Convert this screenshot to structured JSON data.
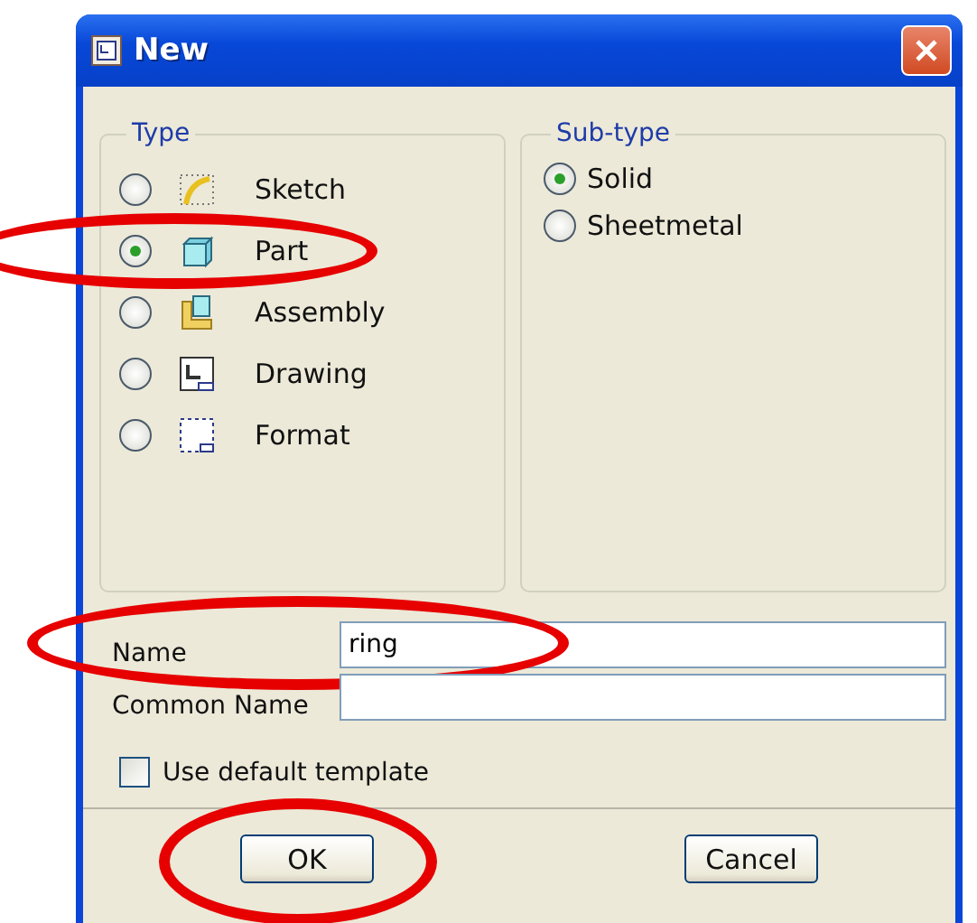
{
  "window": {
    "title": "New"
  },
  "type_group": {
    "label": "Type",
    "items": [
      {
        "label": "Sketch",
        "kind": "sketch",
        "selected": false,
        "circled": false
      },
      {
        "label": "Part",
        "kind": "part",
        "selected": true,
        "circled": true
      },
      {
        "label": "Assembly",
        "kind": "assembly",
        "selected": false,
        "circled": false
      },
      {
        "label": "Drawing",
        "kind": "drawing",
        "selected": false,
        "circled": false
      },
      {
        "label": "Format",
        "kind": "format",
        "selected": false,
        "circled": false
      }
    ]
  },
  "subtype_group": {
    "label": "Sub-type",
    "items": [
      {
        "label": "Solid",
        "selected": true
      },
      {
        "label": "Sheetmetal",
        "selected": false
      }
    ]
  },
  "fields": [
    {
      "label": "Name",
      "value": "ring",
      "circled": true
    },
    {
      "label": "Common Name",
      "circled": false
    }
  ],
  "use_default_template": {
    "label": "Use default template",
    "checked": false
  },
  "buttons": [
    {
      "label": "OK",
      "circled": true
    },
    {
      "label": "Cancel",
      "circled": false
    }
  ]
}
